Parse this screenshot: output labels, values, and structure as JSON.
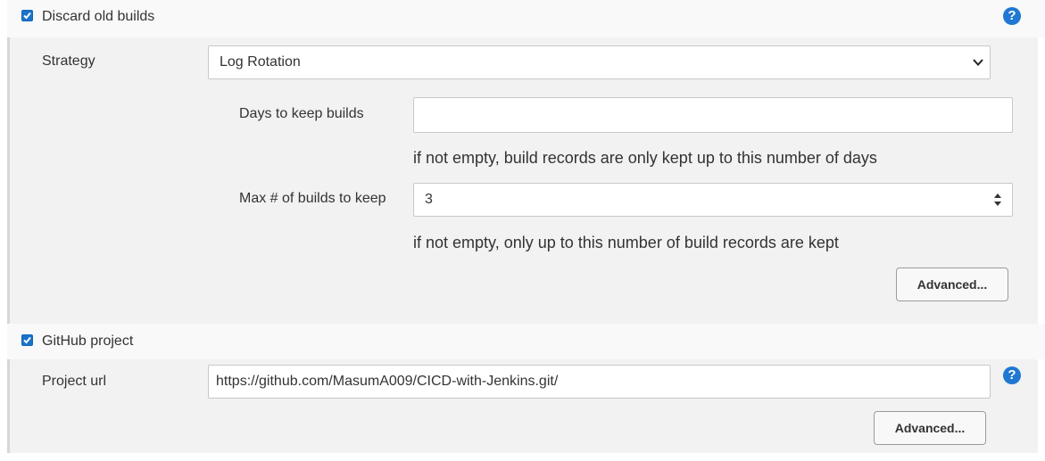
{
  "discard_old_builds": {
    "label": "Discard old builds",
    "checked": true,
    "help_glyph": "?",
    "strategy": {
      "label": "Strategy",
      "selected": "Log Rotation"
    },
    "days_to_keep": {
      "label": "Days to keep builds",
      "value": "",
      "hint": "if not empty, build records are only kept up to this number of days"
    },
    "max_builds": {
      "label": "Max # of builds to keep",
      "value": "3",
      "hint": "if not empty, only up to this number of build records are kept"
    },
    "advanced_label": "Advanced..."
  },
  "github_project": {
    "label": "GitHub project",
    "checked": true,
    "help_glyph": "?",
    "project_url": {
      "label": "Project url",
      "value": "https://github.com/MasumA009/CICD-with-Jenkins.git/"
    },
    "advanced_label": "Advanced..."
  },
  "colors": {
    "accent": "#1a73c9",
    "help": "#1f78d1",
    "panel": "#f2f2f2",
    "header": "#f9f9f9"
  },
  "icons": [
    "check-icon",
    "help-icon",
    "chevron-down-icon",
    "spinner-arrows-icon"
  ]
}
